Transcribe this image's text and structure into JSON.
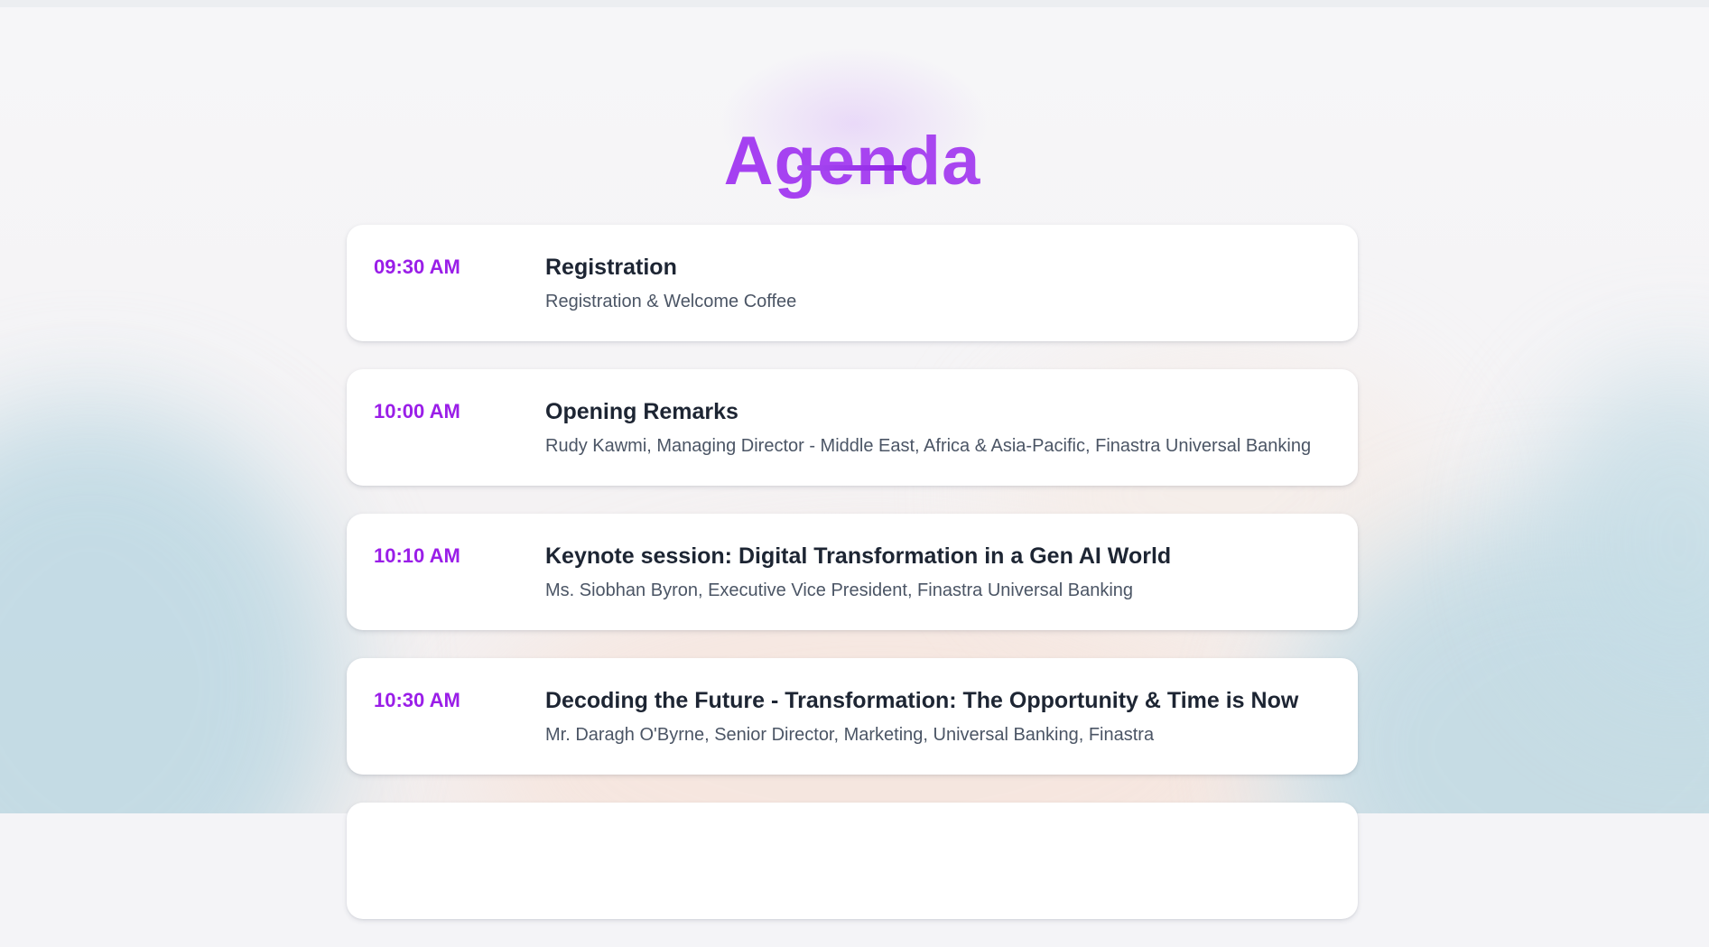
{
  "page": {
    "title": "Agenda"
  },
  "colors": {
    "accent": "#9a1ee8",
    "title_text": "#1d2533",
    "subtitle_text": "#4b5565",
    "card_background": "#ffffff"
  },
  "agenda": {
    "items": [
      {
        "time": "09:30 AM",
        "title": "Registration",
        "subtitle": "Registration & Welcome Coffee"
      },
      {
        "time": "10:00 AM",
        "title": "Opening Remarks",
        "subtitle": "Rudy Kawmi, Managing Director - Middle East, Africa & Asia-Pacific, Finastra Universal Banking"
      },
      {
        "time": "10:10 AM",
        "title": "Keynote session: Digital Transformation in a Gen AI World",
        "subtitle": "Ms. Siobhan Byron, Executive Vice President, Finastra Universal Banking"
      },
      {
        "time": "10:30 AM",
        "title": "Decoding the Future - Transformation: The Opportunity & Time is Now",
        "subtitle": "Mr. Daragh O'Byrne, Senior Director, Marketing, Universal Banking, Finastra"
      }
    ]
  }
}
